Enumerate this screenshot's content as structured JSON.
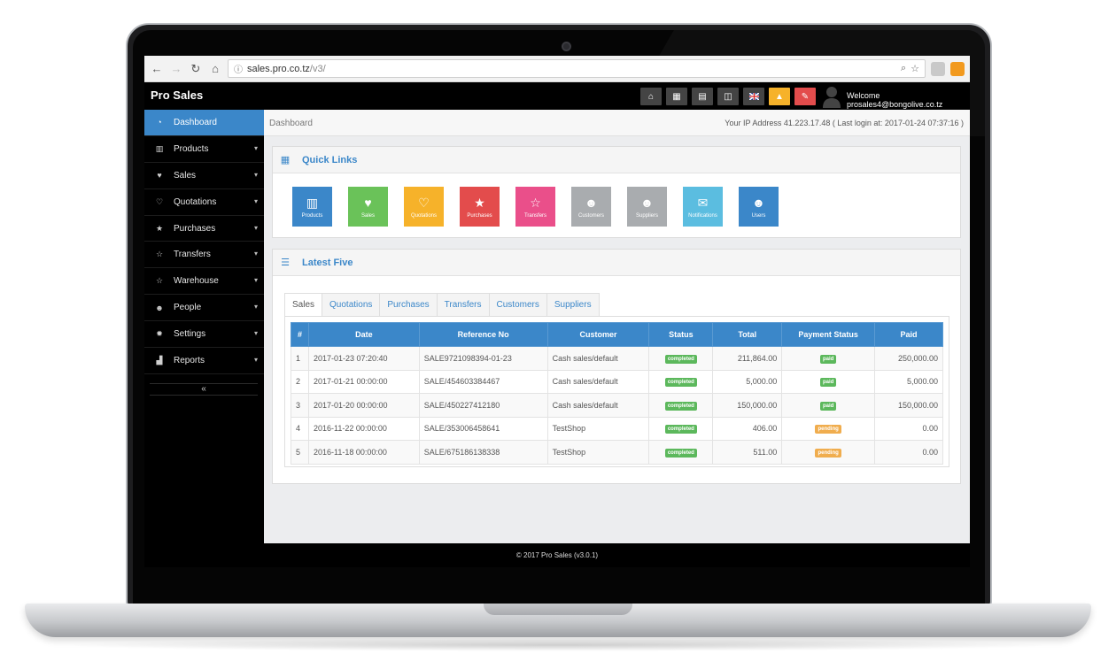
{
  "browser": {
    "url_host": "sales.pro.co.tz",
    "url_path": "/v3/"
  },
  "header": {
    "brand": "Pro Sales",
    "welcome": "Welcome prosales4@bongolive.co.tz",
    "icons": [
      "home-icon",
      "calculator-icon",
      "calendar-icon",
      "html5-icon",
      "flag-uk-icon",
      "warning-icon",
      "eraser-icon"
    ]
  },
  "sidebar": {
    "items": [
      {
        "label": "Dashboard",
        "icon": "dashboard-icon",
        "active": true
      },
      {
        "label": "Products",
        "icon": "barcode-icon"
      },
      {
        "label": "Sales",
        "icon": "heart-icon"
      },
      {
        "label": "Quotations",
        "icon": "heart-outline-icon"
      },
      {
        "label": "Purchases",
        "icon": "star-icon"
      },
      {
        "label": "Transfers",
        "icon": "star-outline-icon"
      },
      {
        "label": "Warehouse",
        "icon": "star-outline-icon"
      },
      {
        "label": "People",
        "icon": "users-icon"
      },
      {
        "label": "Settings",
        "icon": "gear-icon"
      },
      {
        "label": "Reports",
        "icon": "bar-chart-icon"
      }
    ],
    "collapse": "«"
  },
  "breadcrumb": {
    "current": "Dashboard",
    "ip_info": "Your IP Address 41.223.17.48 ( Last login at: 2017-01-24 07:37:16 )"
  },
  "quick_links": {
    "title": "Quick Links",
    "items": [
      {
        "label": "Products",
        "color": "#3b87c9",
        "icon": "barcode-icon"
      },
      {
        "label": "Sales",
        "color": "#6ac259",
        "icon": "heart-icon"
      },
      {
        "label": "Quotations",
        "color": "#f6b22a",
        "icon": "heart-outline-icon"
      },
      {
        "label": "Purchases",
        "color": "#e34c4c",
        "icon": "star-icon"
      },
      {
        "label": "Transfers",
        "color": "#ea4f8a",
        "icon": "star-outline-icon"
      },
      {
        "label": "Customers",
        "color": "#a9acaf",
        "icon": "users-icon"
      },
      {
        "label": "Suppliers",
        "color": "#a9acaf",
        "icon": "users-icon"
      },
      {
        "label": "Notifications",
        "color": "#5bbde0",
        "icon": "chat-icon"
      },
      {
        "label": "Users",
        "color": "#3b87c9",
        "icon": "users-icon"
      }
    ]
  },
  "latest": {
    "title": "Latest Five",
    "tabs": [
      "Sales",
      "Quotations",
      "Purchases",
      "Transfers",
      "Customers",
      "Suppliers"
    ],
    "columns": [
      "#",
      "Date",
      "Reference No",
      "Customer",
      "Status",
      "Total",
      "Payment Status",
      "Paid"
    ],
    "rows": [
      [
        "1",
        "2017-01-23 07:20:40",
        "SALE9721098394-01-23",
        "Cash sales/default",
        "completed",
        "211,864.00",
        "paid",
        "250,000.00"
      ],
      [
        "2",
        "2017-01-21 00:00:00",
        "SALE/454603384467",
        "Cash sales/default",
        "completed",
        "5,000.00",
        "paid",
        "5,000.00"
      ],
      [
        "3",
        "2017-01-20 00:00:00",
        "SALE/450227412180",
        "Cash sales/default",
        "completed",
        "150,000.00",
        "paid",
        "150,000.00"
      ],
      [
        "4",
        "2016-11-22 00:00:00",
        "SALE/353006458641",
        "TestShop",
        "completed",
        "406.00",
        "pending",
        "0.00"
      ],
      [
        "5",
        "2016-11-18 00:00:00",
        "SALE/675186138338",
        "TestShop",
        "completed",
        "511.00",
        "pending",
        "0.00"
      ]
    ],
    "status_colors": {
      "completed": "#5cb85c",
      "paid": "#5cb85c",
      "pending": "#f0ad4e"
    }
  },
  "footer": "© 2017 Pro Sales (v3.0.1)"
}
